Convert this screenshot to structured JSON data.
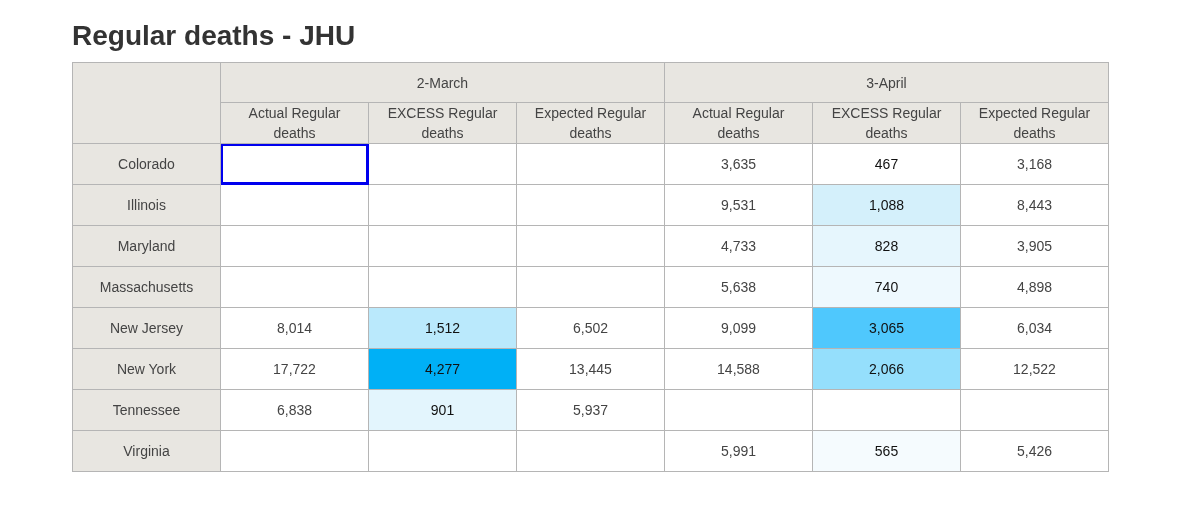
{
  "title": "Regular deaths - JHU",
  "table": {
    "groups": [
      "2-March",
      "3-April"
    ],
    "columns": [
      "Actual Regular deaths",
      "EXCESS Regular deaths",
      "Expected Regular deaths",
      "Actual Regular deaths",
      "EXCESS Regular deaths",
      "Expected Regular deaths"
    ],
    "rows": [
      {
        "label": "Colorado",
        "cells": [
          {
            "selected": true
          },
          {
            "selected": false
          },
          {
            "selected": false
          },
          {
            "text": "3,635",
            "selected": false
          },
          {
            "text": "467",
            "selected": false,
            "color": "#ffffff"
          },
          {
            "text": "3,168",
            "selected": false
          }
        ]
      },
      {
        "label": "Illinois",
        "cells": [
          {
            "selected": false
          },
          {
            "selected": false
          },
          {
            "selected": false
          },
          {
            "text": "9,531",
            "selected": false
          },
          {
            "text": "1,088",
            "selected": false,
            "color": "#d4f0fb"
          },
          {
            "text": "8,443",
            "selected": false
          }
        ]
      },
      {
        "label": "Maryland",
        "cells": [
          {
            "selected": false
          },
          {
            "selected": false
          },
          {
            "selected": false
          },
          {
            "text": "4,733",
            "selected": false
          },
          {
            "text": "828",
            "selected": false,
            "color": "#e6f6fd"
          },
          {
            "text": "3,905",
            "selected": false
          }
        ]
      },
      {
        "label": "Massachusetts",
        "cells": [
          {
            "selected": false
          },
          {
            "selected": false
          },
          {
            "selected": false
          },
          {
            "text": "5,638",
            "selected": false
          },
          {
            "text": "740",
            "selected": false,
            "color": "#eef9fe"
          },
          {
            "text": "4,898",
            "selected": false
          }
        ]
      },
      {
        "label": "New Jersey",
        "cells": [
          {
            "text": "8,014",
            "selected": false
          },
          {
            "text": "1,512",
            "selected": false,
            "color": "#bae9fc"
          },
          {
            "text": "6,502",
            "selected": false
          },
          {
            "text": "9,099",
            "selected": false
          },
          {
            "text": "3,065",
            "selected": false,
            "color": "#4fc8fd"
          },
          {
            "text": "6,034",
            "selected": false
          }
        ]
      },
      {
        "label": "New York",
        "cells": [
          {
            "text": "17,722",
            "selected": false
          },
          {
            "text": "4,277",
            "selected": false,
            "color": "#00b0f6"
          },
          {
            "text": "13,445",
            "selected": false
          },
          {
            "text": "14,588",
            "selected": false
          },
          {
            "text": "2,066",
            "selected": false,
            "color": "#95dffc"
          },
          {
            "text": "12,522",
            "selected": false
          }
        ]
      },
      {
        "label": "Tennessee",
        "cells": [
          {
            "text": "6,838",
            "selected": false
          },
          {
            "text": "901",
            "selected": false,
            "color": "#e3f5fd"
          },
          {
            "text": "5,937",
            "selected": false
          },
          {
            "selected": false
          },
          {
            "selected": false
          },
          {
            "selected": false
          }
        ]
      },
      {
        "label": "Virginia",
        "cells": [
          {
            "selected": false
          },
          {
            "selected": false
          },
          {
            "selected": false
          },
          {
            "text": "5,991",
            "selected": false
          },
          {
            "text": "565",
            "selected": false,
            "color": "#f5fbfe"
          },
          {
            "text": "5,426",
            "selected": false
          }
        ]
      }
    ]
  }
}
